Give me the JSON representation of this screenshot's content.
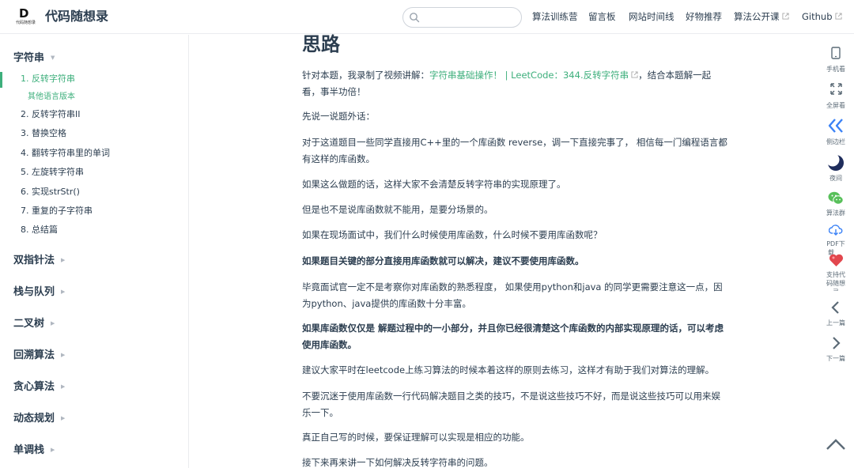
{
  "header": {
    "logo_letter": "D",
    "logo_sub": "代码随想录",
    "site_title": "代码随想录",
    "search_placeholder": "",
    "nav": [
      {
        "label": "算法训练营",
        "external": false
      },
      {
        "label": "留言板",
        "external": false
      },
      {
        "label": "网站时间线",
        "external": false
      },
      {
        "label": "好物推荐",
        "external": false
      },
      {
        "label": "算法公开课",
        "external": true
      },
      {
        "label": "Github",
        "external": true
      }
    ]
  },
  "sidebar": {
    "string_section": {
      "title": "字符串",
      "items": [
        {
          "label": "1. 反转字符串",
          "active": true
        },
        {
          "label": "其他语言版本",
          "sub": true
        },
        {
          "label": "2. 反转字符串II"
        },
        {
          "label": "3. 替换空格"
        },
        {
          "label": "4. 翻转字符串里的单词"
        },
        {
          "label": "5. 左旋转字符串"
        },
        {
          "label": "6. 实现strStr()"
        },
        {
          "label": "7. 重复的子字符串"
        },
        {
          "label": "8. 总结篇"
        }
      ]
    },
    "sections": [
      "双指针法",
      "栈与队列",
      "二叉树",
      "回溯算法",
      "贪心算法",
      "动态规划",
      "单调栈"
    ]
  },
  "content": {
    "heading": "思路",
    "p1_a": "针对本题，我录制了视频讲解：",
    "p1_link": "字符串基础操作！ | LeetCode：344.反转字符串",
    "p1_b": "，结合本题解一起",
    "p1_c": "看，事半功倍！",
    "p2": "先说一说题外话：",
    "p3_a": "对于这道题目一些同学直接用C++里的一个库函数 reverse，调一下直接完事了， 相信每一门编程语言都",
    "p3_b": "有这样的库函数。",
    "p4": "如果这么做题的话，这样大家不会清楚反转字符串的实现原理了。",
    "p5": "但是也不是说库函数就不能用，是要分场景的。",
    "p6": "如果在现场面试中，我们什么时候使用库函数，什么时候不要用库函数呢？",
    "p7": "如果题目关键的部分直接用库函数就可以解决，建议不要使用库函数。",
    "p8_a": "毕竟面试官一定不是考察你对库函数的熟悉程度， 如果使用python和java 的同学更需要注意这一点，因",
    "p8_b": "为python、java提供的库函数十分丰富。",
    "p9_a": "如果库函数仅仅是 解题过程中的一小部分，并且你已经很清楚这个库函数的内部实现原理的话，可以考虑",
    "p9_b": "使用库函数。",
    "p10": "建议大家平时在leetcode上练习算法的时候本着这样的原则去练习，这样才有助于我们对算法的理解。",
    "p11_a": "不要沉迷于使用库函数一行代码解决题目之类的技巧，不是说这些技巧不好，而是说这些技巧可以用来娱",
    "p11_b": "乐一下。",
    "p12": "真正自己写的时候，要保证理解可以实现是相应的功能。",
    "p13": "接下来再来讲一下如何解决反转字符串的问题。"
  },
  "toolbar": {
    "mobile": "手机看",
    "fullscreen": "全屏看",
    "sidebar": "侧边栏",
    "night": "夜间",
    "group": "算法群",
    "pdf_a": "PDF下",
    "pdf_b": "载",
    "support_a": "支持代",
    "support_b": "码随想",
    "support_c": "录",
    "prev": "上一篇",
    "next": "下一篇"
  },
  "colors": {
    "accent": "#3eaf7c",
    "text": "#2c3e50",
    "muted": "#5c6b77",
    "toolbar_blue": "#3b82f6",
    "night_navy": "#1f2d5c",
    "wechat_green": "#58c05a",
    "heart_red": "#e2474e"
  }
}
